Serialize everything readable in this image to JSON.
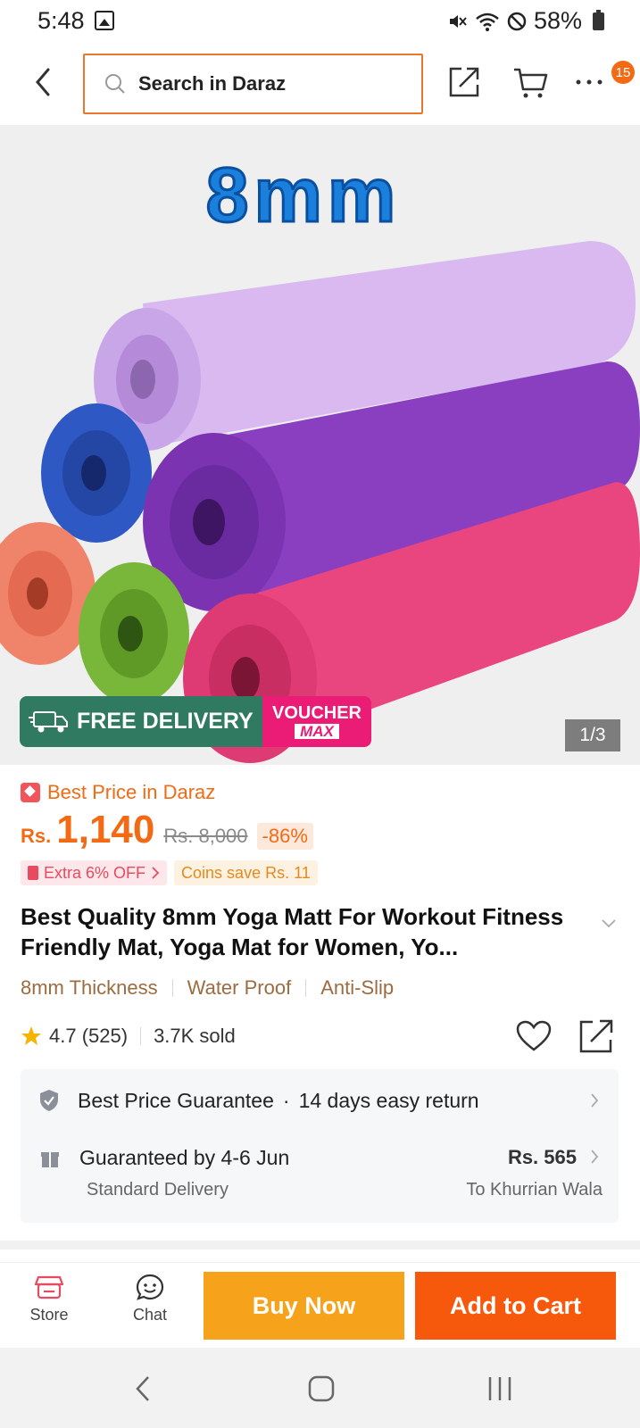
{
  "status": {
    "time": "5:48",
    "battery": "58%"
  },
  "header": {
    "search_placeholder": "Search in Daraz",
    "cart_badge": "15"
  },
  "hero": {
    "headline": "8mm",
    "free_tag": "FREE",
    "free_delivery": "FREE DELIVERY",
    "voucher_top": "VOUCHER",
    "voucher_bottom": "MAX",
    "page_indicator": "1/3",
    "mat_colors": [
      "#c9a6e8",
      "#8a3fc0",
      "#2e58c4",
      "#e9457f",
      "#79b73a",
      "#f0846a"
    ]
  },
  "pricing": {
    "best_price_label": "Best Price in Daraz",
    "currency": "Rs.",
    "price": "1,140",
    "old_price": "Rs. 8,000",
    "discount": "-86%",
    "extra_off": "Extra 6% OFF",
    "coins_save": "Coins save Rs. 11"
  },
  "product": {
    "title": "Best Quality 8mm Yoga Matt For Workout Fitness Friendly Mat, Yoga Mat for Women, Yo...",
    "tags": [
      "8mm Thickness",
      "Water Proof",
      "Anti-Slip"
    ],
    "rating": "4.7 (525)",
    "sold": "3.7K sold"
  },
  "info": {
    "guarantee": "Best Price Guarantee",
    "returns": "14 days easy return",
    "delivery_date": "Guaranteed by 4-6 Jun",
    "delivery_type": "Standard Delivery",
    "delivery_fee": "Rs. 565",
    "destination": "To Khurrian Wala"
  },
  "actions": {
    "store": "Store",
    "chat": "Chat",
    "buy_now": "Buy Now",
    "add_to_cart": "Add to Cart"
  },
  "colors": {
    "accent": "#f36a14",
    "buy_now": "#f7a21b",
    "add_to_cart": "#f6590c",
    "delivery_green": "#2f7a61",
    "voucher_pink": "#ea1c75"
  }
}
